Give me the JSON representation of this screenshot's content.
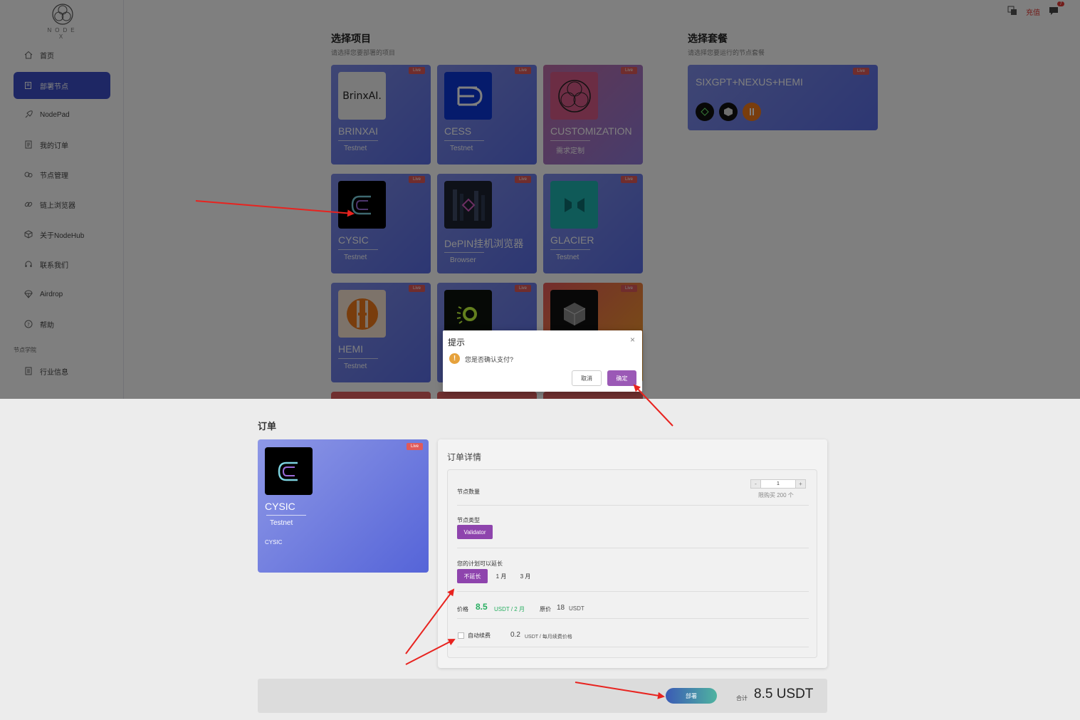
{
  "brand": {
    "logo_text": "NODE X"
  },
  "header": {
    "recharge_label": "充值",
    "notification_count": "7"
  },
  "sidebar": {
    "items": [
      {
        "label": "首页",
        "icon": "home-icon"
      },
      {
        "label": "部署节点",
        "icon": "deploy-icon",
        "active": true
      },
      {
        "label": "NodePad",
        "icon": "rocket-icon"
      },
      {
        "label": "我的订单",
        "icon": "order-icon"
      },
      {
        "label": "节点管理",
        "icon": "manage-icon"
      },
      {
        "label": "链上浏览器",
        "icon": "link-icon"
      },
      {
        "label": "关于NodeHub",
        "icon": "cube-icon"
      },
      {
        "label": "联系我们",
        "icon": "headset-icon"
      },
      {
        "label": "Airdrop",
        "icon": "parachute-icon"
      },
      {
        "label": "帮助",
        "icon": "help-icon"
      }
    ],
    "section_label": "节点学院",
    "section_items": [
      {
        "label": "行业信息",
        "icon": "doc-icon"
      }
    ]
  },
  "projects": {
    "title": "选择项目",
    "subtitle": "请选择您要部署的项目",
    "live_label": "Live",
    "cards": [
      {
        "name": "BRINXAI",
        "tag": "Testnet",
        "thumb_text": "BrinxAI."
      },
      {
        "name": "CESS",
        "tag": "Testnet"
      },
      {
        "name": "CUSTOMIZATION",
        "tag": "需求定制"
      },
      {
        "name": "CYSIC",
        "tag": "Testnet"
      },
      {
        "name": "DePIN挂机浏览器",
        "tag": "Browser"
      },
      {
        "name": "GLACIER",
        "tag": "Testnet"
      },
      {
        "name": "HEMI",
        "tag": "Testnet"
      },
      {
        "name": "",
        "tag": ""
      },
      {
        "name": "",
        "tag": ""
      }
    ]
  },
  "packages": {
    "title": "选择套餐",
    "subtitle": "请选择您要运行的节点套餐",
    "live_label": "Live",
    "items": [
      {
        "name": "SIXGPT+NEXUS+HEMI"
      }
    ]
  },
  "dialog": {
    "title": "提示",
    "message": "您是否确认支付?",
    "cancel_label": "取消",
    "confirm_label": "确定",
    "close_glyph": "×",
    "warn_glyph": "!"
  },
  "order": {
    "title": "订单",
    "card": {
      "name": "CYSIC",
      "tag": "Testnet",
      "description": "CYSIC",
      "live_label": "Live"
    },
    "details_title": "订单详情",
    "quantity_label": "节点数量",
    "quantity_value": "1",
    "quantity_minus": "-",
    "quantity_plus": "+",
    "quantity_limit": "限购买 200 个",
    "type_label": "节点类型",
    "type_options": [
      "Validator"
    ],
    "extend_label": "您的计划可以延长",
    "extend_options": [
      "不延长",
      "1 月",
      "3 月"
    ],
    "price_label": "价格",
    "price_value": "8.5",
    "price_unit": "USDT / 2 月",
    "original_label": "原价",
    "original_value": "18",
    "original_unit": "USDT",
    "auto_renew_label": "自动续费",
    "auto_renew_value": "0.2",
    "auto_renew_unit": "USDT / 每月续费价格",
    "deploy_label": "部署",
    "total_label": "合计",
    "total_value": "8.5 USDT"
  },
  "colors": {
    "accent": "#3d4fc8",
    "purple": "#8e44ad",
    "live": "#e05a5a",
    "price": "#27ae60",
    "arrow": "#e8231f"
  }
}
